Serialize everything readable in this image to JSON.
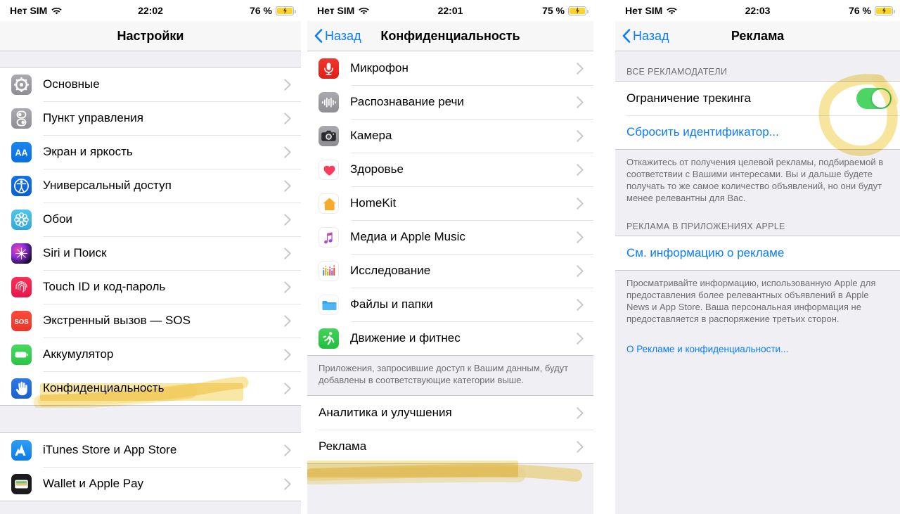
{
  "panels": [
    {
      "id": "settings",
      "status": {
        "carrier": "Нет SIM",
        "time": "22:02",
        "battery": "76 %"
      },
      "nav": {
        "title": "Настройки"
      },
      "groups": [
        {
          "rows": [
            {
              "label": "Основные",
              "icon": "gear-icon"
            },
            {
              "label": "Пункт управления",
              "icon": "control-center-icon"
            },
            {
              "label": "Экран и яркость",
              "icon": "display-brightness-icon"
            },
            {
              "label": "Универсальный доступ",
              "icon": "accessibility-icon"
            },
            {
              "label": "Обои",
              "icon": "wallpaper-icon"
            },
            {
              "label": "Siri и Поиск",
              "icon": "siri-icon"
            },
            {
              "label": "Touch ID и код-пароль",
              "icon": "touch-id-icon"
            },
            {
              "label": "Экстренный вызов — SOS",
              "icon": "sos-icon"
            },
            {
              "label": "Аккумулятор",
              "icon": "battery-icon"
            },
            {
              "label": "Конфиденциальность",
              "icon": "privacy-hand-icon",
              "highlighted": true
            }
          ]
        },
        {
          "rows": [
            {
              "label": "iTunes Store и App Store",
              "icon": "app-store-icon"
            },
            {
              "label": "Wallet и Apple Pay",
              "icon": "wallet-icon"
            }
          ]
        }
      ]
    },
    {
      "id": "privacy",
      "status": {
        "carrier": "Нет SIM",
        "time": "22:01",
        "battery": "75 %"
      },
      "nav": {
        "back": "Назад",
        "title": "Конфиденциальность"
      },
      "groups": [
        {
          "rows": [
            {
              "label": "Микрофон",
              "icon": "microphone-icon"
            },
            {
              "label": "Распознавание речи",
              "icon": "speech-recognition-icon"
            },
            {
              "label": "Камера",
              "icon": "camera-icon"
            },
            {
              "label": "Здоровье",
              "icon": "health-icon"
            },
            {
              "label": "HomeKit",
              "icon": "homekit-icon"
            },
            {
              "label": "Медиа и Apple Music",
              "icon": "apple-music-icon"
            },
            {
              "label": "Исследование",
              "icon": "research-icon"
            },
            {
              "label": "Файлы и папки",
              "icon": "files-folder-icon"
            },
            {
              "label": "Движение и фитнес",
              "icon": "motion-fitness-icon"
            }
          ],
          "footnote": "Приложения, запросившие доступ к Вашим данным, будут добавлены в соответствующие категории выше."
        },
        {
          "rows": [
            {
              "label": "Аналитика и улучшения",
              "icon": null
            },
            {
              "label": "Реклама",
              "icon": null,
              "highlighted": true
            }
          ]
        }
      ]
    },
    {
      "id": "advertising",
      "status": {
        "carrier": "Нет SIM",
        "time": "22:03",
        "battery": "76 %"
      },
      "nav": {
        "back": "Назад",
        "title": "Реклама"
      },
      "section_all_advertisers": "ВСЕ РЕКЛАМОДАТЕЛИ",
      "limit_tracking_label": "Ограничение трекинга",
      "limit_tracking_on": true,
      "reset_identifier_label": "Сбросить идентификатор...",
      "footnote_1": "Откажитесь от получения целевой рекламы, подбираемой в соответствии с Вашими интересами. Вы и дальше будете получать то же самое количество объявлений, но они будут менее релевантны для Вас.",
      "section_apple_apps": "РЕКЛАМА В ПРИЛОЖЕНИЯХ APPLE",
      "view_ad_info_label": "См. информацию о рекламе",
      "footnote_2": "Просматривайте информацию, использованную Apple для предоставления более релевантных объявлений в Apple News и App Store. Ваша персональная информация не предоставляется в распоряжение третьих сторон.",
      "about_ads_privacy_label": "О Рекламе и конфиденциальности..."
    }
  ],
  "colors": {
    "accent_blue": "#0a7cff",
    "toggle_green": "#4cd464",
    "highlighter_yellow": "#f7e08c",
    "battery_yellow": "#fcd32a",
    "group_bg": "#ffffff",
    "page_bg": "#efeff4"
  }
}
